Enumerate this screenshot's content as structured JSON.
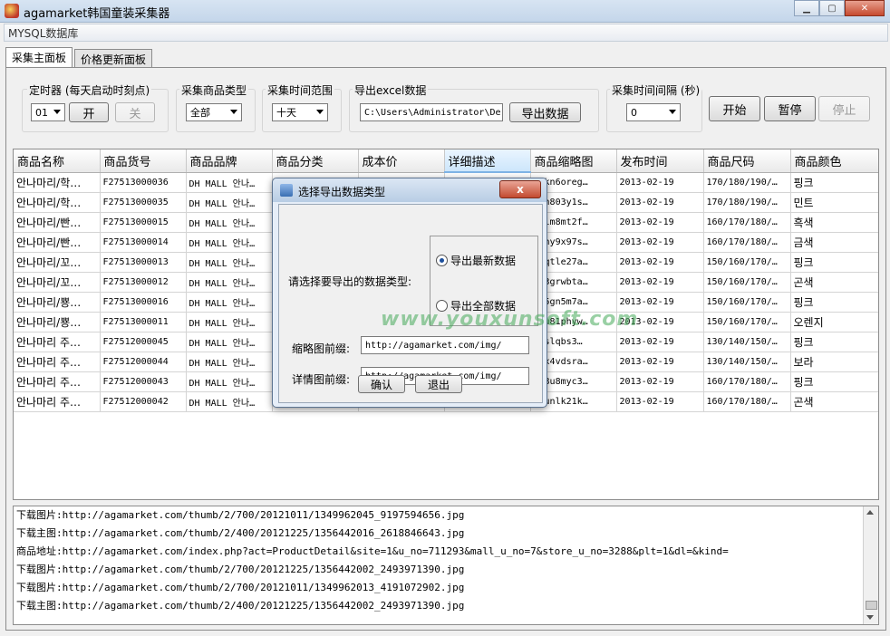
{
  "window": {
    "title": "agamarket韩国童装采集器"
  },
  "menu": {
    "label": "MYSQL数据库"
  },
  "tabs": [
    {
      "label": "采集主面板"
    },
    {
      "label": "价格更新面板"
    }
  ],
  "controls": {
    "timer": {
      "label": "定时器 (每天启动时刻点)",
      "value": "01",
      "open_label": "开",
      "close_label": "关"
    },
    "product_type": {
      "label": "采集商品类型",
      "value": "全部"
    },
    "time_range": {
      "label": "采集时间范围",
      "value": "十天"
    },
    "export": {
      "label": "导出excel数据",
      "path": "C:\\Users\\Administrator\\De",
      "button": "导出数据"
    },
    "interval": {
      "label": "采集时间间隔 (秒)",
      "value": "0"
    },
    "start_label": "开始",
    "pause_label": "暂停",
    "stop_label": "停止"
  },
  "table": {
    "columns": [
      "商品名称",
      "商品货号",
      "商品品牌",
      "商品分类",
      "成本价",
      "详细描述",
      "商品缩略图",
      "发布时间",
      "商品尺码",
      "商品颜色"
    ],
    "rows": [
      [
        "안나마리/학…",
        "F27513000036",
        "DH MALL 안나…",
        "",
        "",
        "",
        "rukn6oreg…",
        "2013-02-19",
        "170/180/190/…",
        "핑크"
      ],
      [
        "안나마리/학…",
        "F27513000035",
        "DH MALL 안나…",
        "",
        "",
        "",
        "1ah803y1s…",
        "2013-02-19",
        "170/180/190/…",
        "민트"
      ],
      [
        "안나마리/빤…",
        "F27513000015",
        "DH MALL 안나…",
        "",
        "",
        "",
        "ruim8mt2f…",
        "2013-02-19",
        "160/170/180/…",
        "흑색"
      ],
      [
        "안나마리/빤…",
        "F27513000014",
        "DH MALL 안나…",
        "",
        "",
        "",
        "cony9x97s…",
        "2013-02-19",
        "160/170/180/…",
        "금색"
      ],
      [
        "안나마리/꼬…",
        "F27513000013",
        "DH MALL 안나…",
        "",
        "",
        "",
        "opqtle27a…",
        "2013-02-19",
        "150/160/170/…",
        "핑크"
      ],
      [
        "안나마리/꼬…",
        "F27513000012",
        "DH MALL 안나…",
        "",
        "",
        "",
        "kd3grwbta…",
        "2013-02-19",
        "150/160/170/…",
        "곤색"
      ],
      [
        "안나마리/뿅…",
        "F27513000016",
        "DH MALL 안나…",
        "",
        "",
        "",
        "ty5gn5m7a…",
        "2013-02-19",
        "150/160/170/…",
        "핑크"
      ],
      [
        "안나마리/뿅…",
        "F27513000011",
        "DH MALL 안나…",
        "",
        "",
        "",
        "qtu81phyw…",
        "2013-02-19",
        "150/160/170/…",
        "오렌지"
      ],
      [
        "안나마리 주…",
        "F27512000045",
        "DH MALL 안나…",
        "",
        "",
        "",
        "uqslqbs3…",
        "2013-02-19",
        "130/140/150/…",
        "핑크"
      ],
      [
        "안나마리 주…",
        "F27512000044",
        "DH MALL 안나…",
        "",
        "",
        "",
        "nrx4vdsra…",
        "2013-02-19",
        "130/140/150/…",
        "보라"
      ],
      [
        "안나마리 주…",
        "F27512000043",
        "DH MALL 안나…",
        "",
        "",
        "",
        "d38u8myc3…",
        "2013-02-19",
        "160/170/180/…",
        "핑크"
      ],
      [
        "안나마리 주…",
        "F27512000042",
        "DH MALL 안나…",
        "",
        "",
        "",
        "ysunlk21k…",
        "2013-02-19",
        "160/170/180/…",
        "곤색"
      ]
    ]
  },
  "log": [
    "下载图片:http://agamarket.com/thumb/2/700/20121011/1349962045_9197594656.jpg",
    "下载主图:http://agamarket.com/thumb/2/400/20121225/1356442016_2618846643.jpg",
    "商品地址:http://agamarket.com/index.php?act=ProductDetail&site=1&u_no=711293&mall_u_no=7&store_u_no=3288&plt=1&dl=&kind=",
    "下载图片:http://agamarket.com/thumb/2/700/20121225/1356442002_2493971390.jpg",
    "下载图片:http://agamarket.com/thumb/2/700/20121011/1349962013_4191072902.jpg",
    "下载主图:http://agamarket.com/thumb/2/400/20121225/1356442002_2493971390.jpg"
  ],
  "dialog": {
    "title": "选择导出数据类型",
    "close_label": "x",
    "prompt": "请选择要导出的数据类型:",
    "option_latest": "导出最新数据",
    "option_all": "导出全部数据",
    "thumb_prefix_label": "缩略图前缀:",
    "thumb_prefix_value": "http://agamarket.com/img/",
    "detail_prefix_label": "详情图前缀:",
    "detail_prefix_value": "http://agamarket.com/img/",
    "ok_label": "确认",
    "exit_label": "退出"
  },
  "watermark": {
    "text": "www.youxunsoft.com"
  },
  "icons": {
    "app": "app-logo-icon",
    "dialog": "java-cup-icon",
    "minimize": "minimize-icon",
    "maximize": "maximize-icon",
    "close": "close-icon",
    "dropdown": "chevron-down-icon"
  }
}
